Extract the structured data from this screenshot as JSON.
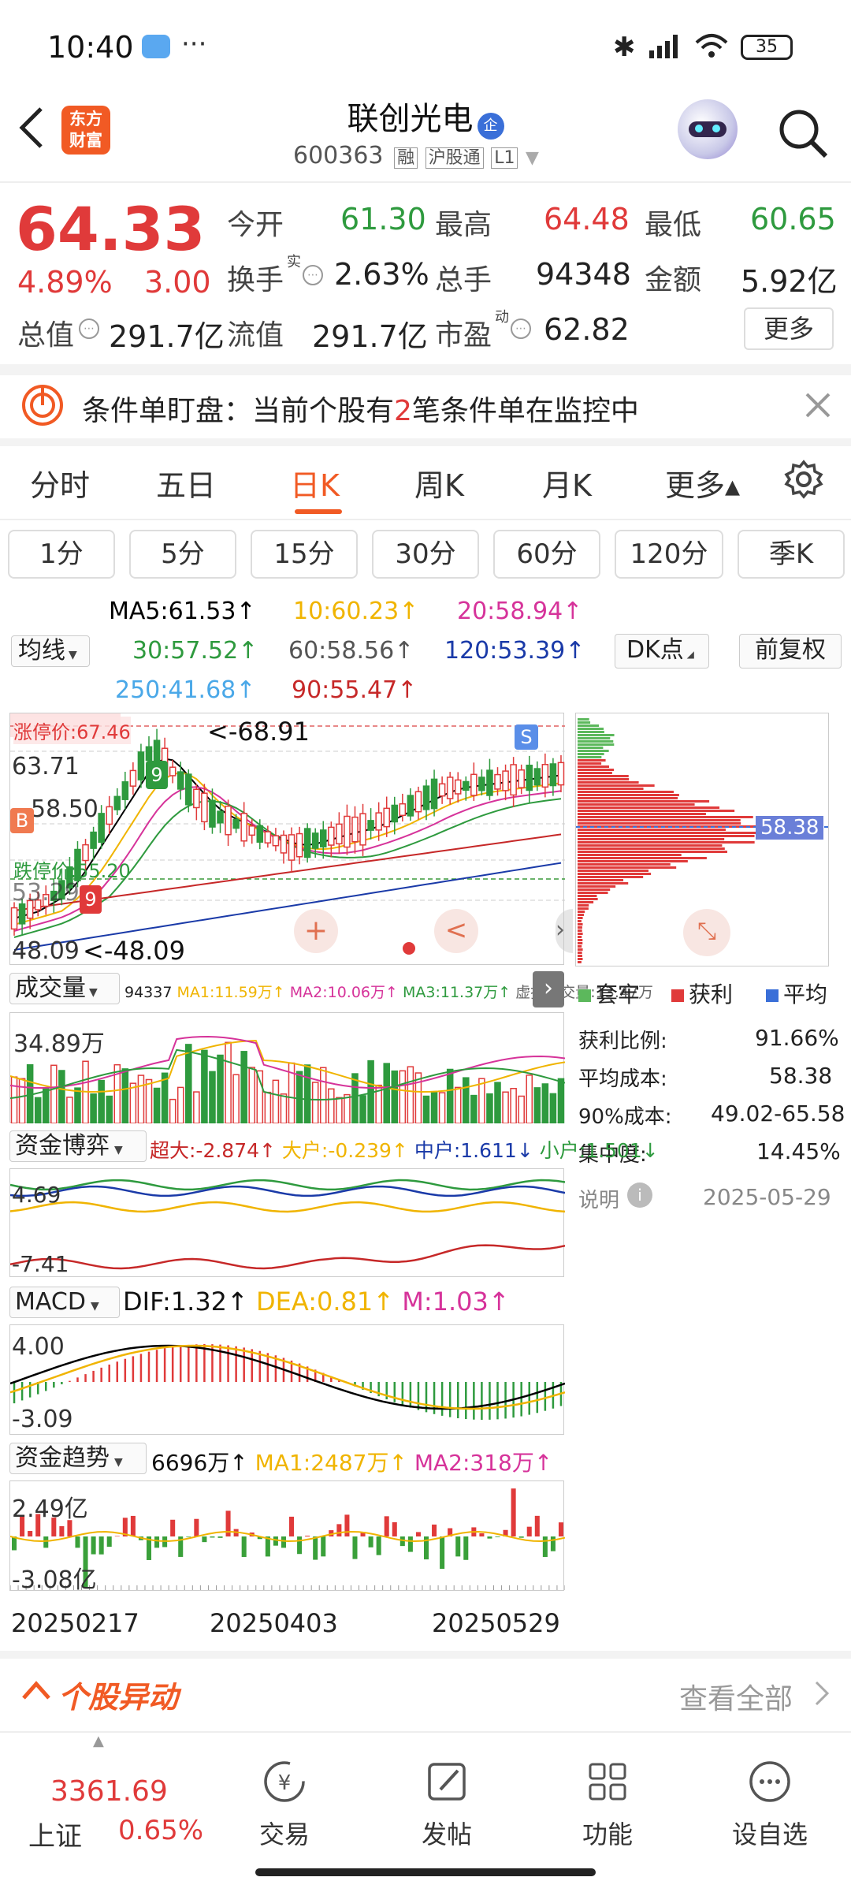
{
  "status_bar": {
    "time": "10:40",
    "more": "···",
    "battery": "35"
  },
  "header": {
    "logo_line1": "东方",
    "logo_line2": "财富",
    "stock_name": "联创光电",
    "enterprise_badge": "企",
    "stock_code": "600363",
    "tags": [
      "融",
      "沪股通",
      "L1"
    ]
  },
  "quote": {
    "price": "64.33",
    "change_pct": "4.89%",
    "change_amt": "3.00",
    "open_label": "今开",
    "open": "61.30",
    "high_label": "最高",
    "high": "64.48",
    "low_label": "最低",
    "low": "60.65",
    "turnover_label": "换手",
    "turnover_sup": "实",
    "turnover": "2.63%",
    "volume_label": "总手",
    "volume": "94348",
    "amount_label": "金额",
    "amount": "5.92亿",
    "mktcap_label": "总值",
    "mktcap": "291.7亿",
    "float_label": "流值",
    "float_cap": "291.7亿",
    "pe_label": "市盈",
    "pe_sup": "动",
    "pe": "62.82",
    "more_button": "更多"
  },
  "banner": {
    "text_before": "条件单盯盘：当前个股有",
    "count": "2",
    "text_after": "笔条件单在监控中"
  },
  "tabs": [
    {
      "label": "分时"
    },
    {
      "label": "五日"
    },
    {
      "label": "日K",
      "active": true
    },
    {
      "label": "周K"
    },
    {
      "label": "月K"
    },
    {
      "label": "更多▴"
    }
  ],
  "periods": [
    "1分",
    "5分",
    "15分",
    "30分",
    "60分",
    "120分",
    "季K"
  ],
  "ma": {
    "ma5": "MA5:61.53↑",
    "ma10": "10:60.23↑",
    "ma20": "20:58.94↑",
    "ma30": "30:57.52↑",
    "ma60": "60:58.56↑",
    "ma120": "120:53.39↑",
    "ma250": "250:41.68↑",
    "ma90": "90:55.47↑",
    "selector": "均线",
    "dk_button": "DK点",
    "adjust_button": "前复权"
  },
  "kline": {
    "limit_up": "涨停价:67.46",
    "limit_down": "跌停价:55.20",
    "y_labels": [
      "63.71",
      "58.50",
      "53.29",
      "48.09"
    ],
    "high_mark": "<-68.91",
    "low_mark": "<-48.09",
    "badges": [
      "B",
      "9",
      "9"
    ],
    "s_badge": "S"
  },
  "chip": {
    "avg_price_tag": "58.38",
    "legend": [
      "套牢",
      "获利",
      "平均"
    ],
    "profit_ratio_label": "获利比例:",
    "profit_ratio": "91.66%",
    "avg_cost_label": "平均成本:",
    "avg_cost": "58.38",
    "cost90_label": "90%成本:",
    "cost90": "49.02-65.58",
    "concentration_label": "集中度:",
    "concentration": "14.45%",
    "note_label": "说明",
    "date": "2025-05-29"
  },
  "volume_panel": {
    "name": "成交量",
    "vol": "94337",
    "ma1": "MA1:11.59万↑",
    "ma2": "MA2:10.06万↑",
    "ma3": "MA3:11.37万↑",
    "virtual": "虚拟成交量:13.47万",
    "y_label": "34.89万"
  },
  "fund_game": {
    "name": "资金博弈",
    "super": "超大:-2.874↑",
    "big": "大户:-0.239↑",
    "mid": "中户:1.611↓",
    "small": "小户:1.501↓",
    "y_top": "4.69",
    "y_bottom": "-7.41"
  },
  "macd": {
    "name": "MACD",
    "dif": "DIF:1.32↑",
    "dea": "DEA:0.81↑",
    "m": "M:1.03↑",
    "y_top": "4.00",
    "y_bottom": "-3.09"
  },
  "fund_trend": {
    "name": "资金趋势",
    "val": "6696万↑",
    "ma1": "MA1:2487万↑",
    "ma2": "MA2:318万↑",
    "y_top": "2.49亿",
    "y_bottom": "-3.08亿"
  },
  "dates": [
    "20250217",
    "20250403",
    "20250529"
  ],
  "movement": {
    "title": "个股异动",
    "view_all": "查看全部"
  },
  "bottom_nav": {
    "index_value": "3361.69",
    "index_name": "上证",
    "index_change": "0.65%",
    "items": [
      "交易",
      "发帖",
      "功能",
      "设自选"
    ]
  },
  "colors": {
    "up": "#e03a3a",
    "down": "#2e9a3e",
    "brand": "#f15a24",
    "ma5": "#000000",
    "ma10": "#f0b400",
    "ma20": "#d6339a",
    "ma30": "#2e9a3e",
    "ma60": "#555555",
    "ma120": "#1a3aa8",
    "ma250": "#4aa8e8",
    "ma90": "#c62828"
  }
}
